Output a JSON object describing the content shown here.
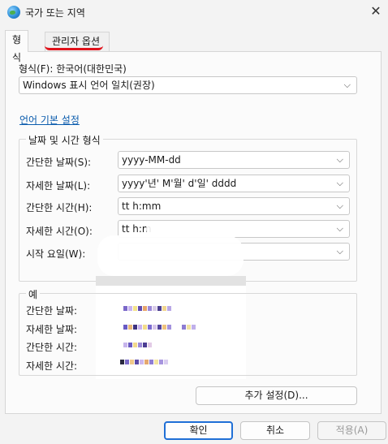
{
  "window": {
    "title": "국가 또는 지역",
    "close_glyph": "✕"
  },
  "tabs": [
    {
      "label": "형식",
      "active": true
    },
    {
      "label": "관리자 옵션",
      "active": false
    }
  ],
  "format": {
    "label": "형식(F): 한국어(대한민국)",
    "value": "Windows 표시 언어 일치(권장)"
  },
  "link": {
    "label": "언어 기본 설정"
  },
  "datetime_group": {
    "title": "날짜 및 시간 형식",
    "rows": [
      {
        "label": "간단한 날짜(S):",
        "value": "yyyy-MM-dd"
      },
      {
        "label": "자세한 날짜(L):",
        "value": "yyyy'년' M'월' d'일' dddd"
      },
      {
        "label": "간단한 시간(H):",
        "value": "tt h:mm"
      },
      {
        "label": "자세한 시간(O):",
        "value": "tt h:m"
      },
      {
        "label": "시작 요일(W):",
        "value": ""
      }
    ]
  },
  "example_group": {
    "title": "예",
    "rows": [
      {
        "label": "간단한 날짜:"
      },
      {
        "label": "자세한 날짜:"
      },
      {
        "label": "간단한 시간:"
      },
      {
        "label": "자세한 시간:"
      }
    ]
  },
  "buttons": {
    "additional": "추가 설정(D)...",
    "ok": "확인",
    "cancel": "취소",
    "apply": "적용(A)"
  },
  "icons": {
    "chevron": "chevron-down-icon",
    "globe": "globe-icon"
  },
  "colors": {
    "accent": "#1f6fd6",
    "link": "#0b5cad",
    "highlight_stroke": "#e0121b"
  }
}
